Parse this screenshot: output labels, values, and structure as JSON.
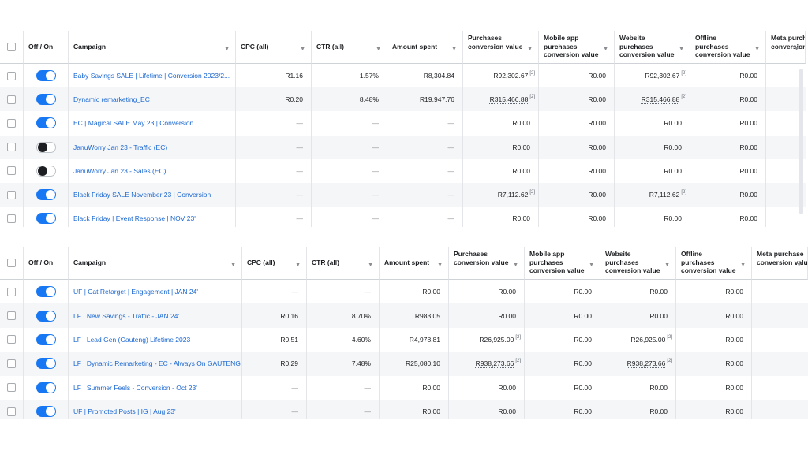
{
  "top_table": {
    "columns": [
      {
        "label": "Off / On"
      },
      {
        "label": "Campaign"
      },
      {
        "label": "CPC (all)"
      },
      {
        "label": "CTR (all)"
      },
      {
        "label": "Amount spent"
      },
      {
        "label": "Purchases\nconversion value"
      },
      {
        "label": "Mobile app\npurchases\nconversion value"
      },
      {
        "label": "Website\npurchases\nconversion value"
      },
      {
        "label": "Offline\npurchases\nconversion value"
      },
      {
        "label": "Meta purchase\nconversion value"
      }
    ],
    "rows": [
      {
        "on": true,
        "campaign": "Baby Savings SALE | Lifetime | Conversion 2023/2...",
        "cpc": "R1.16",
        "ctr": "1.57%",
        "spent": "R8,304.84",
        "purchases": "R92,302.67",
        "purchases_note": "[2]",
        "mobile": "R0.00",
        "website": "R92,302.67",
        "website_note": "[2]",
        "offline": "R0.00"
      },
      {
        "on": true,
        "campaign": "Dynamic remarketing_EC",
        "cpc": "R0.20",
        "ctr": "8.48%",
        "spent": "R19,947.76",
        "purchases": "R315,466.88",
        "purchases_note": "[2]",
        "mobile": "R0.00",
        "website": "R315,466.88",
        "website_note": "[2]",
        "offline": "R0.00"
      },
      {
        "on": true,
        "campaign": "EC | Magical SALE May 23 | Conversion",
        "cpc": "—",
        "ctr": "—",
        "spent": "—",
        "purchases": "R0.00",
        "purchases_note": "",
        "mobile": "R0.00",
        "website": "R0.00",
        "website_note": "",
        "offline": "R0.00"
      },
      {
        "on": false,
        "campaign": "JanuWorry Jan 23 - Traffic (EC)",
        "cpc": "—",
        "ctr": "—",
        "spent": "—",
        "purchases": "R0.00",
        "purchases_note": "",
        "mobile": "R0.00",
        "website": "R0.00",
        "website_note": "",
        "offline": "R0.00"
      },
      {
        "on": false,
        "campaign": "JanuWorry Jan 23 - Sales (EC)",
        "cpc": "—",
        "ctr": "—",
        "spent": "—",
        "purchases": "R0.00",
        "purchases_note": "",
        "mobile": "R0.00",
        "website": "R0.00",
        "website_note": "",
        "offline": "R0.00"
      },
      {
        "on": true,
        "campaign": "Black Friday SALE November 23 | Conversion",
        "cpc": "—",
        "ctr": "—",
        "spent": "—",
        "purchases": "R7,112.62",
        "purchases_note": "[2]",
        "mobile": "R0.00",
        "website": "R7,112.62",
        "website_note": "[2]",
        "offline": "R0.00"
      },
      {
        "on": true,
        "campaign": "Black Friday | Event Response | NOV 23'",
        "cpc": "—",
        "ctr": "—",
        "spent": "—",
        "purchases": "R0.00",
        "purchases_note": "",
        "mobile": "R0.00",
        "website": "R0.00",
        "website_note": "",
        "offline": "R0.00"
      }
    ]
  },
  "bottom_table": {
    "columns": [
      {
        "label": "Off / On"
      },
      {
        "label": "Campaign"
      },
      {
        "label": "CPC (all)"
      },
      {
        "label": "CTR (all)"
      },
      {
        "label": "Amount spent"
      },
      {
        "label": "Purchases\nconversion value"
      },
      {
        "label": "Mobile app\npurchases\nconversion value"
      },
      {
        "label": "Website\npurchases\nconversion value"
      },
      {
        "label": "Offline\npurchases\nconversion value"
      },
      {
        "label": "Meta purchase\nconversion value"
      }
    ],
    "rows": [
      {
        "on": true,
        "campaign": "UF | Cat Retarget | Engagement | JAN 24'",
        "cpc": "—",
        "ctr": "—",
        "spent": "R0.00",
        "purchases": "R0.00",
        "purchases_note": "",
        "mobile": "R0.00",
        "website": "R0.00",
        "website_note": "",
        "offline": "R0.00"
      },
      {
        "on": true,
        "campaign": "LF | New Savings - Traffic - JAN 24'",
        "cpc": "R0.16",
        "ctr": "8.70%",
        "spent": "R983.05",
        "purchases": "R0.00",
        "purchases_note": "",
        "mobile": "R0.00",
        "website": "R0.00",
        "website_note": "",
        "offline": "R0.00"
      },
      {
        "on": true,
        "campaign": "LF | Lead Gen (Gauteng) Lifetime 2023",
        "cpc": "R0.51",
        "ctr": "4.60%",
        "spent": "R4,978.81",
        "purchases": "R26,925.00",
        "purchases_note": "[2]",
        "mobile": "R0.00",
        "website": "R26,925.00",
        "website_note": "[2]",
        "offline": "R0.00"
      },
      {
        "on": true,
        "campaign": "LF | Dynamic Remarketing - EC - Always On GAUTENG",
        "cpc": "R0.29",
        "ctr": "7.48%",
        "spent": "R25,080.10",
        "purchases": "R938,273.66",
        "purchases_note": "[2]",
        "mobile": "R0.00",
        "website": "R938,273.66",
        "website_note": "[2]",
        "offline": "R0.00"
      },
      {
        "on": true,
        "campaign": "LF | Summer Feels - Conversion - Oct 23'",
        "cpc": "—",
        "ctr": "—",
        "spent": "R0.00",
        "purchases": "R0.00",
        "purchases_note": "",
        "mobile": "R0.00",
        "website": "R0.00",
        "website_note": "",
        "offline": "R0.00"
      },
      {
        "on": true,
        "campaign": "UF | Promoted Posts | IG | Aug 23'",
        "cpc": "—",
        "ctr": "—",
        "spent": "R0.00",
        "purchases": "R0.00",
        "purchases_note": "",
        "mobile": "R0.00",
        "website": "R0.00",
        "website_note": "",
        "offline": "R0.00"
      }
    ]
  },
  "colors": {
    "toggle_on": "#1877f2",
    "link": "#1a67d2",
    "row_alt": "#f5f6f7"
  },
  "icons": {
    "sort": "chevron-down-icon"
  }
}
